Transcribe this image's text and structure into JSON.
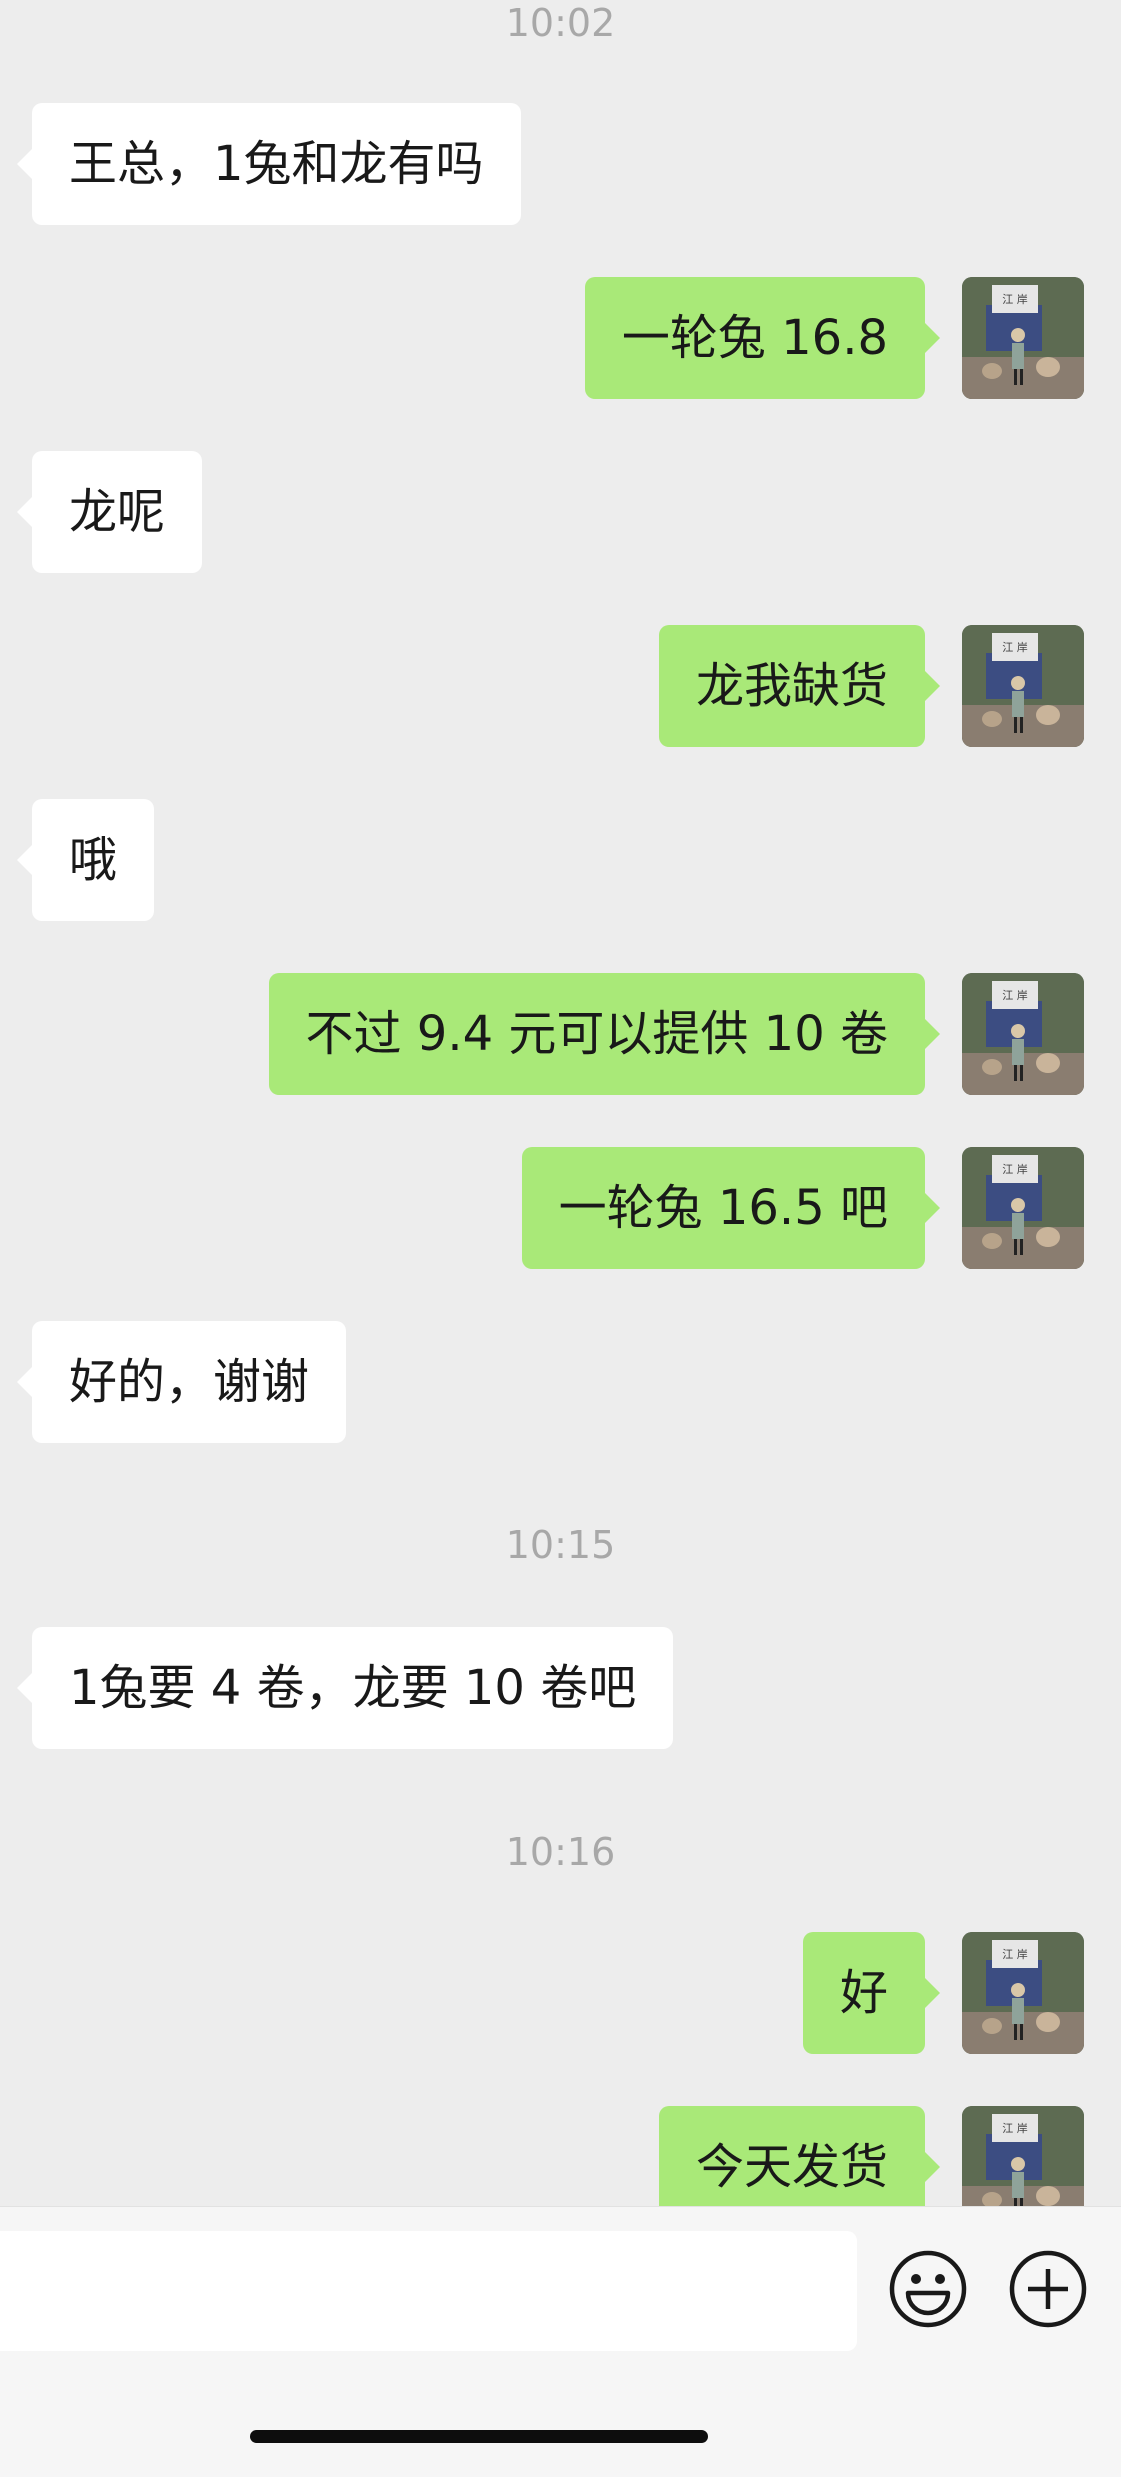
{
  "timestamps": [
    "10:02",
    "10:15",
    "10:16"
  ],
  "messages": [
    {
      "sender": "other",
      "text": "王总，1兔和龙有吗"
    },
    {
      "sender": "self",
      "text": "一轮兔 16.8"
    },
    {
      "sender": "other",
      "text": "龙呢"
    },
    {
      "sender": "self",
      "text": "龙我缺货"
    },
    {
      "sender": "other",
      "text": "哦"
    },
    {
      "sender": "self",
      "text": "不过 9.4 元可以提供 10 卷"
    },
    {
      "sender": "self",
      "text": "一轮兔 16.5 吧"
    },
    {
      "sender": "other",
      "text": "好的，谢谢"
    },
    {
      "sender": "other",
      "text": "1兔要 4 卷，龙要 10 卷吧"
    },
    {
      "sender": "self",
      "text": "好"
    },
    {
      "sender": "self",
      "text": "今天发货"
    }
  ],
  "avatar_sign_text": "江 岸",
  "input_bar": {
    "input_value": "",
    "emoji_icon": "emoji-icon",
    "plus_icon": "plus-icon"
  },
  "colors": {
    "background": "#ededed",
    "incoming_bubble": "#ffffff",
    "outgoing_bubble": "#a9e978",
    "timestamp": "#a8a8a8"
  }
}
